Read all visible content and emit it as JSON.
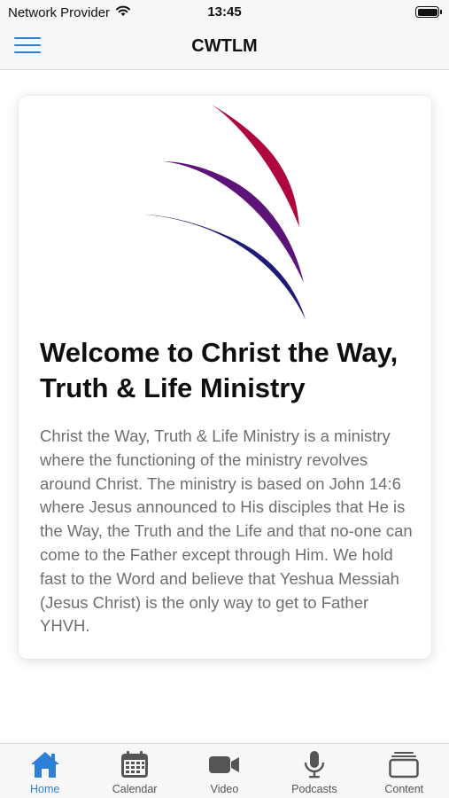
{
  "status_bar": {
    "carrier": "Network Provider",
    "time": "13:45",
    "wifi_icon": "wifi-icon",
    "battery_icon": "battery-full-icon"
  },
  "nav_bar": {
    "title": "CWTLM",
    "menu_icon": "hamburger-menu-icon"
  },
  "card": {
    "logo": "cwtlm-flame-logo",
    "title": "Welcome to Christ the Way, Truth & Life Ministry",
    "body": "Christ the Way, Truth & Life Ministry is a ministry where the functioning of the ministry revolves around Christ. The ministry is based on John 14:6 where Jesus announced to His disciples that He is the Way, the Truth and the Life and that no-one can come to the Father except through Him. We hold fast to the Word and believe that Yeshua Messiah (Jesus Christ) is the only way to get to Father YHVH."
  },
  "tab_bar": {
    "active_tab": "Home",
    "tabs": [
      {
        "label": "Home",
        "icon": "home-icon"
      },
      {
        "label": "Calendar",
        "icon": "calendar-icon"
      },
      {
        "label": "Video",
        "icon": "video-camera-icon"
      },
      {
        "label": "Podcasts",
        "icon": "microphone-icon"
      },
      {
        "label": "Content",
        "icon": "stacked-content-icon"
      }
    ]
  },
  "colors": {
    "accent": "#2F7FD6",
    "logo_crimson": "#B0063E",
    "logo_purple": "#5C1478",
    "logo_navy": "#1E1A78",
    "body_text": "#6F6F6F",
    "inactive_icon": "#555555"
  }
}
